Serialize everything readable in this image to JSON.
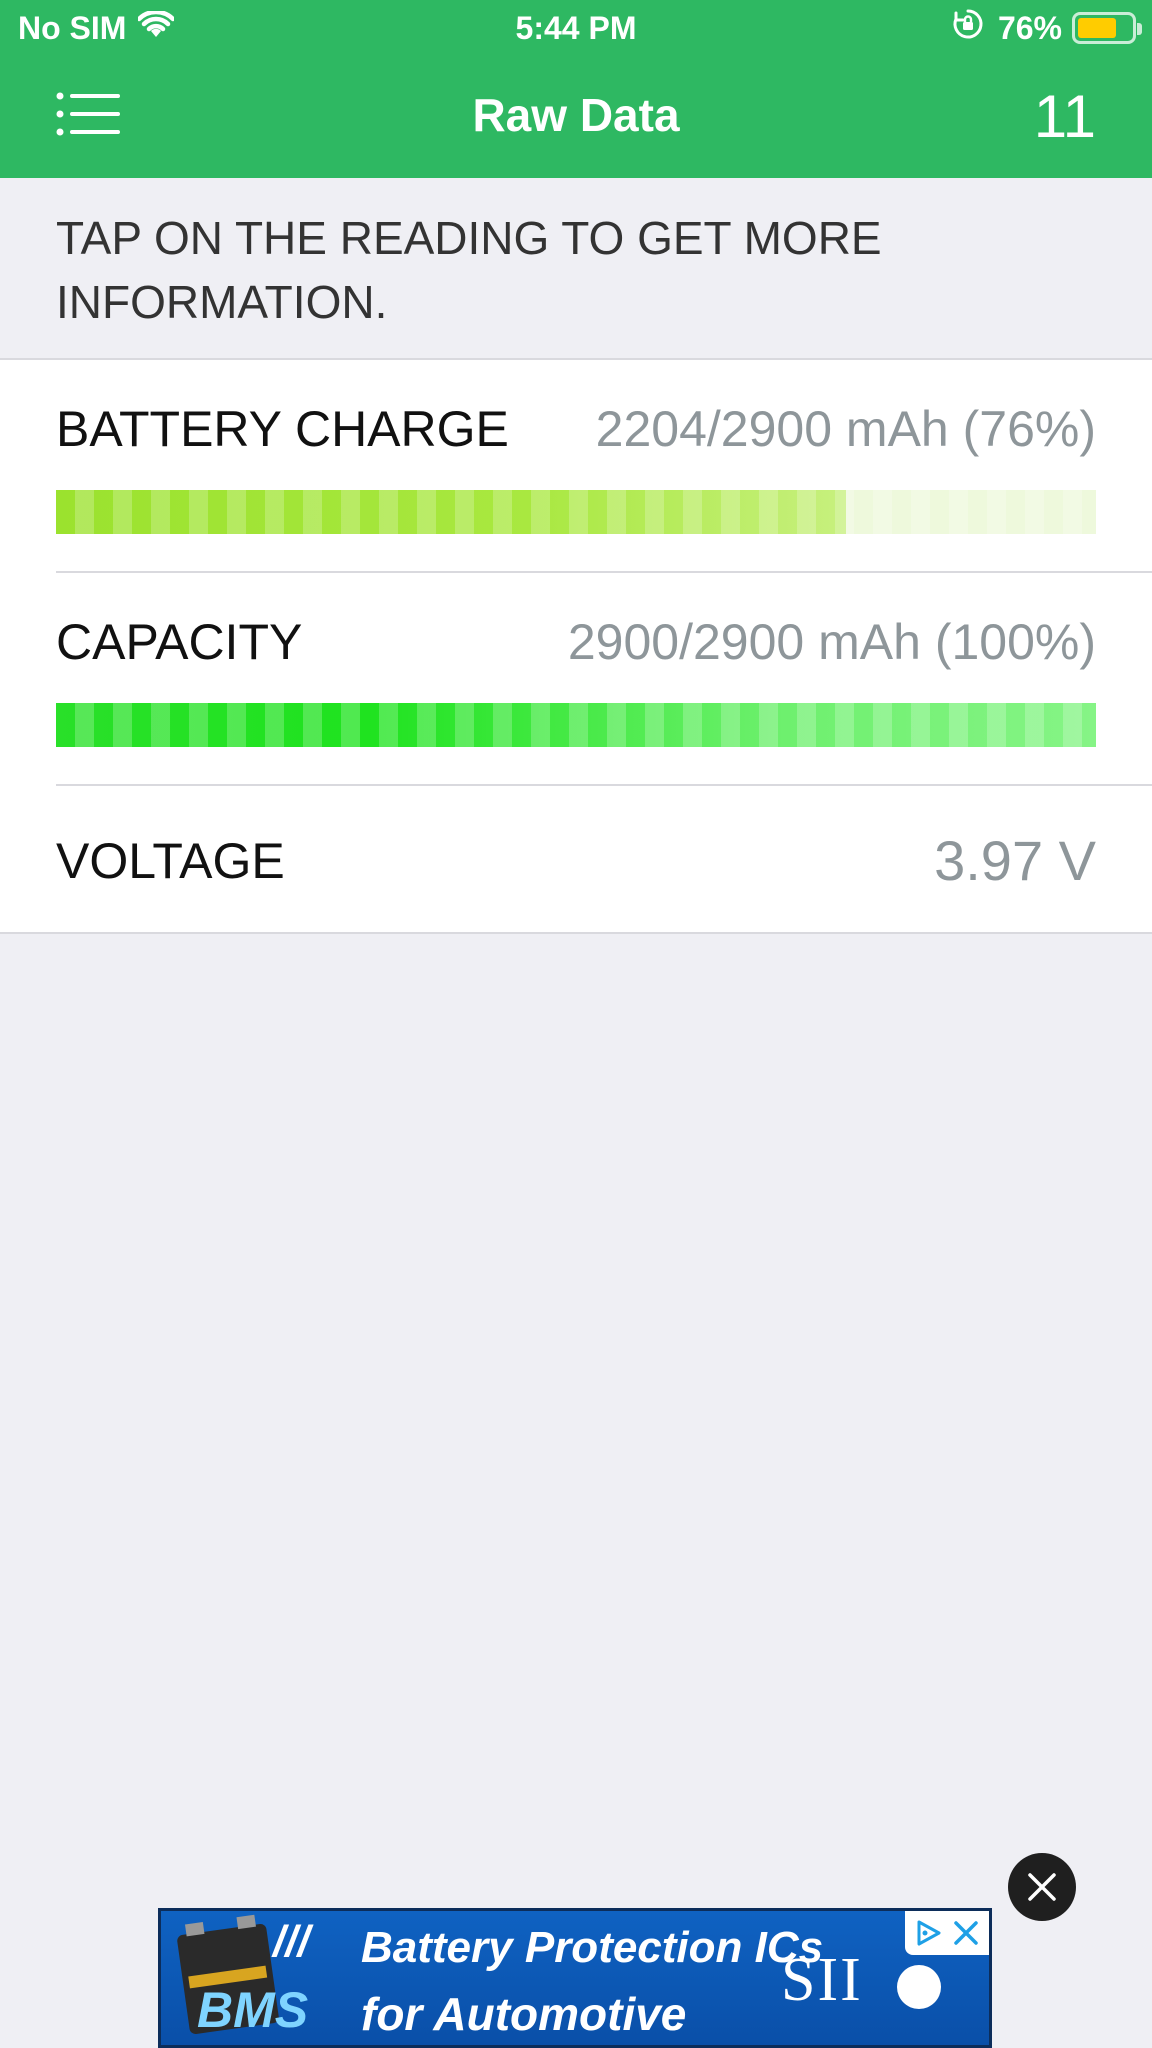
{
  "status_bar": {
    "carrier": "No SIM",
    "time": "5:44 PM",
    "battery_percent": "76%",
    "battery_level": 0.76,
    "battery_color": "#ffcc00",
    "icons": [
      "wifi-icon",
      "orientation-lock-icon",
      "battery-icon"
    ]
  },
  "nav": {
    "title": "Raw Data",
    "count": "11",
    "menu_icon": "list-menu-icon",
    "bar_color": "#2eb862"
  },
  "hint": "TAP ON THE READING TO GET MORE INFORMATION.",
  "readings": [
    {
      "label": "BATTERY CHARGE",
      "value": "2204/2900 mAh (76%)",
      "level": 0.76
    },
    {
      "label": "CAPACITY",
      "value": "2900/2900 mAh (100%)",
      "level": 1.0
    },
    {
      "label": "VOLTAGE",
      "value": "3.97 V"
    }
  ],
  "ad": {
    "line1": "Battery Protection ICs",
    "line2": "for Automotive",
    "tag": "BMS",
    "brand": "SII",
    "icons": [
      "ad-choices-icon",
      "close-icon"
    ]
  }
}
